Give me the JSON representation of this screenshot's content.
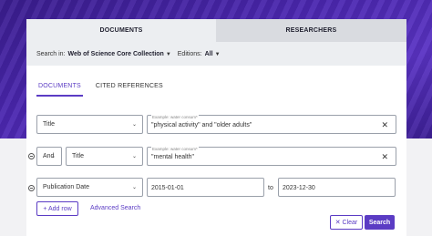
{
  "top_tabs": {
    "documents": "DOCUMENTS",
    "researchers": "RESEARCHERS"
  },
  "search_in": {
    "label": "Search in:",
    "collection": "Web of Science Core Collection",
    "editions_label": "Editions:",
    "editions_value": "All"
  },
  "sub_tabs": {
    "documents": "DOCUMENTS",
    "cited_references": "CITED REFERENCES"
  },
  "rows": [
    {
      "field": "Title",
      "placeholder": "Example: water consum*",
      "value": "\"physical activity\" and \"older adults\""
    },
    {
      "operator": "And",
      "field": "Title",
      "placeholder": "Example: water consum*",
      "value": "\"mental health\""
    },
    {
      "field": "Publication Date",
      "from": "2015-01-01",
      "to_label": "to",
      "to": "2023-12-30"
    }
  ],
  "actions": {
    "add_row": "+ Add row",
    "advanced_search": "Advanced Search",
    "clear": "✕ Clear",
    "search": "Search"
  },
  "colors": {
    "accent": "#5b3cc4",
    "banner": "#4b27b0"
  }
}
